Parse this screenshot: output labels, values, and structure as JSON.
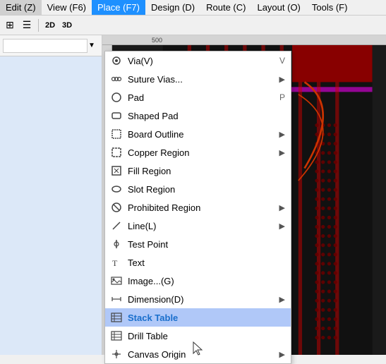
{
  "menubar": {
    "items": [
      {
        "id": "edit",
        "label": "Edit (Z)"
      },
      {
        "id": "view",
        "label": "View (F6)"
      },
      {
        "id": "place",
        "label": "Place (F7)",
        "active": true
      },
      {
        "id": "design",
        "label": "Design (D)"
      },
      {
        "id": "route",
        "label": "Route (C)"
      },
      {
        "id": "layout",
        "label": "Layout (O)"
      },
      {
        "id": "tools",
        "label": "Tools (F)"
      }
    ]
  },
  "toolbar": {
    "buttons": [
      {
        "id": "grid",
        "label": "⊞"
      },
      {
        "id": "list",
        "label": "☰"
      },
      {
        "id": "view2d",
        "label": "2D"
      },
      {
        "id": "view3d",
        "label": "3D"
      }
    ]
  },
  "dropdown": {
    "items": [
      {
        "id": "via",
        "icon": "circle-dot",
        "label": "Via(V)",
        "shortcut": "V",
        "arrow": false
      },
      {
        "id": "suture-vias",
        "icon": "star",
        "label": "Suture Vias...",
        "shortcut": "",
        "arrow": true
      },
      {
        "id": "pad",
        "icon": "circle",
        "label": "Pad",
        "shortcut": "P",
        "arrow": false
      },
      {
        "id": "shaped-pad",
        "icon": "rect",
        "label": "Shaped Pad",
        "shortcut": "",
        "arrow": false
      },
      {
        "id": "board-outline",
        "icon": "board-outline",
        "label": "Board Outline",
        "shortcut": "",
        "arrow": true
      },
      {
        "id": "copper-region",
        "icon": "copper",
        "label": "Copper Region",
        "shortcut": "",
        "arrow": true
      },
      {
        "id": "fill-region",
        "icon": "fill",
        "label": "Fill Region",
        "shortcut": "",
        "arrow": false
      },
      {
        "id": "slot-region",
        "icon": "slot",
        "label": "Slot Region",
        "shortcut": "",
        "arrow": false
      },
      {
        "id": "prohibited-region",
        "icon": "prohibited",
        "label": "Prohibited Region",
        "shortcut": "",
        "arrow": true
      },
      {
        "id": "line",
        "icon": "line",
        "label": "Line(L)",
        "shortcut": "",
        "arrow": true
      },
      {
        "id": "test-point",
        "icon": "test-point",
        "label": "Test Point",
        "shortcut": "",
        "arrow": false
      },
      {
        "id": "text",
        "icon": "text",
        "label": "Text",
        "shortcut": "",
        "arrow": false
      },
      {
        "id": "image",
        "icon": "image",
        "label": "Image...(G)",
        "shortcut": "",
        "arrow": false
      },
      {
        "id": "dimension",
        "icon": "dimension",
        "label": "Dimension(D)",
        "shortcut": "",
        "arrow": true
      },
      {
        "id": "stack-table",
        "icon": "table",
        "label": "Stack Table",
        "shortcut": "",
        "arrow": false,
        "highlighted": true
      },
      {
        "id": "drill-table",
        "icon": "drill-table",
        "label": "Drill Table",
        "shortcut": "",
        "arrow": false
      },
      {
        "id": "canvas-origin",
        "icon": "canvas-origin",
        "label": "Canvas Origin",
        "shortcut": "",
        "arrow": true
      }
    ]
  },
  "ruler": {
    "label": "500"
  },
  "canvas": {
    "bg_color": "#1a1a1a"
  },
  "cursor": {
    "symbol": "🖱"
  }
}
